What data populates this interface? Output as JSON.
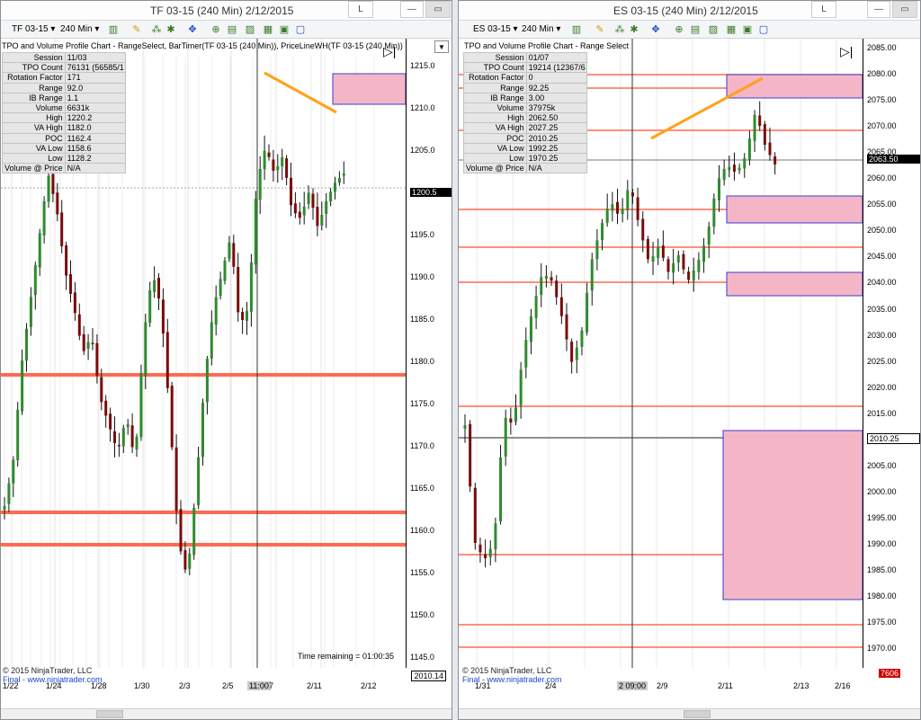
{
  "left": {
    "title": "TF 03-15 (240 Min)  2/12/2015",
    "toolbar": {
      "instrument": "TF 03-15",
      "interval": "240 Min"
    },
    "indicator": "TPO and Volume Profile Chart - RangeSelect, BarTimer(TF 03-15 (240 Min)), PriceLineWH(TF 03-15 (240 Min))",
    "tpo": [
      [
        "Session",
        "11/03"
      ],
      [
        "TPO Count",
        "76131 (56585/1"
      ],
      [
        "Rotation Factor",
        "171"
      ],
      [
        "Range",
        "92.0"
      ],
      [
        "IB Range",
        "1.1"
      ],
      [
        "Volume",
        "6631k"
      ],
      [
        "High",
        "1220.2"
      ],
      [
        "VA High",
        "1182.0"
      ],
      [
        "POC",
        "1162.4"
      ],
      [
        "VA Low",
        "1158.6"
      ],
      [
        "Low",
        "1128.2"
      ],
      [
        "Volume @ Price",
        "N/A"
      ]
    ],
    "price_ticks": [
      "1215.0",
      "1210.0",
      "1205.0",
      "1200.5",
      "1195.0",
      "1190.0",
      "1185.0",
      "1180.0",
      "1175.0",
      "1170.0",
      "1165.0",
      "1160.0",
      "1155.0",
      "1150.0",
      "1145.0"
    ],
    "current_price": "1200.5",
    "status_value": "2010.14",
    "time_remaining": "Time remaining = 01:00:35",
    "dates": [
      "1/22",
      "1/24",
      "1/28",
      "1/30",
      "2/3",
      "2/5",
      "11:00",
      "7",
      "2/11",
      "2/12"
    ],
    "copyright": "© 2015 NinjaTrader, LLC",
    "copyright_link": "www.ninjatrader.com"
  },
  "right": {
    "title": "ES 03-15 (240 Min)  2/12/2015",
    "toolbar": {
      "instrument": "ES 03-15",
      "interval": "240 Min"
    },
    "indicator": "TPO and Volume Profile Chart - Range Select",
    "tpo": [
      [
        "Session",
        "01/07"
      ],
      [
        "TPO Count",
        "19214 (12367/6"
      ],
      [
        "Rotation Factor",
        "0"
      ],
      [
        "Range",
        "92.25"
      ],
      [
        "IB Range",
        "3.00"
      ],
      [
        "Volume",
        "37975k"
      ],
      [
        "High",
        "2062.50"
      ],
      [
        "VA High",
        "2027.25"
      ],
      [
        "POC",
        "2010.25"
      ],
      [
        "VA Low",
        "1992.25"
      ],
      [
        "Low",
        "1970.25"
      ],
      [
        "Volume @ Price",
        "N/A"
      ]
    ],
    "price_ticks": [
      "2085.00",
      "2080.00",
      "2075.00",
      "2070.00",
      "2065.00",
      "2060.00",
      "2055.00",
      "2050.00",
      "2045.00",
      "2040.00",
      "2035.00",
      "2030.00",
      "2025.00",
      "2020.00",
      "2015.00",
      "2010.25",
      "2005.00",
      "2000.00",
      "1995.00",
      "1990.00",
      "1985.00",
      "1980.00",
      "1975.00",
      "1970.00"
    ],
    "current_price": "2063.50",
    "crosshair_price": "2010.25",
    "status_value": "7606",
    "dates": [
      "1/31",
      "2/4",
      "2 09:00",
      "2/9",
      "2/11",
      "2/13",
      "2/16"
    ],
    "copyright": "© 2015 NinjaTrader, LLC",
    "copyright_link": "www.ninjatrader.com"
  },
  "colors": {
    "up": "#2e8b2e",
    "down": "#7a0a0a",
    "level": "#ff6a50",
    "zone_fill": "#f4b6c6",
    "zone_stroke": "#3b3bd4",
    "trend": "#ffa21a"
  }
}
